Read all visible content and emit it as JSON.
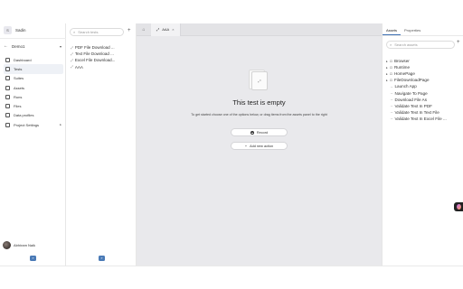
{
  "workspace": {
    "initial": "S",
    "name": "Sadin"
  },
  "project": {
    "name": "Demo1"
  },
  "nav": {
    "items": [
      {
        "label": "Dashboard",
        "icon": "dashboard-icon"
      },
      {
        "label": "Tests",
        "icon": "tests-icon",
        "active": true
      },
      {
        "label": "Suites",
        "icon": "suites-icon"
      },
      {
        "label": "Assets",
        "icon": "assets-icon"
      },
      {
        "label": "Runs",
        "icon": "runs-icon"
      },
      {
        "label": "Files",
        "icon": "files-icon"
      },
      {
        "label": "Data profiles",
        "icon": "data-profiles-icon"
      },
      {
        "label": "Project Settings",
        "icon": "settings-icon",
        "chevron": "▸"
      }
    ]
  },
  "user": {
    "name": "Abhiram Naik"
  },
  "chat_icon": "»",
  "tests": {
    "search_placeholder": "Search tests",
    "add": "+",
    "items": [
      "PDF File Download ...",
      "Text File Download ...",
      "Excel File Download...",
      "AAA"
    ]
  },
  "editor": {
    "tab_label": "AAA",
    "tab_close": "×",
    "empty_title": "This test is empty",
    "empty_hint": "To get started choose one of the options below, or drag items from the assets panel to the right",
    "record_label": "Record",
    "add_action_label": "Add new action",
    "add_action_icon": "+"
  },
  "assets": {
    "tabs": [
      "Assets",
      "Properties"
    ],
    "search_placeholder": "Search assets",
    "add": "+",
    "items": [
      {
        "label": "Browser",
        "expandable": true
      },
      {
        "label": "Runtime",
        "expandable": true
      },
      {
        "label": "HomePage",
        "expandable": true
      },
      {
        "label": "FileDownloadPage",
        "expandable": true
      },
      {
        "label": "Launch App",
        "expandable": false
      },
      {
        "label": "Navigate To Page",
        "expandable": false
      },
      {
        "label": "Download File As",
        "expandable": false
      },
      {
        "label": "Validate Text In PDF",
        "expandable": false
      },
      {
        "label": "Validate Text In Text File",
        "expandable": false
      },
      {
        "label": "Validate Text In Excel File ...",
        "expandable": false
      }
    ]
  },
  "colors": {
    "accent": "#3b6fb3",
    "editor_bg": "#e9e9ec",
    "chat_button": "#4a7ab6"
  }
}
